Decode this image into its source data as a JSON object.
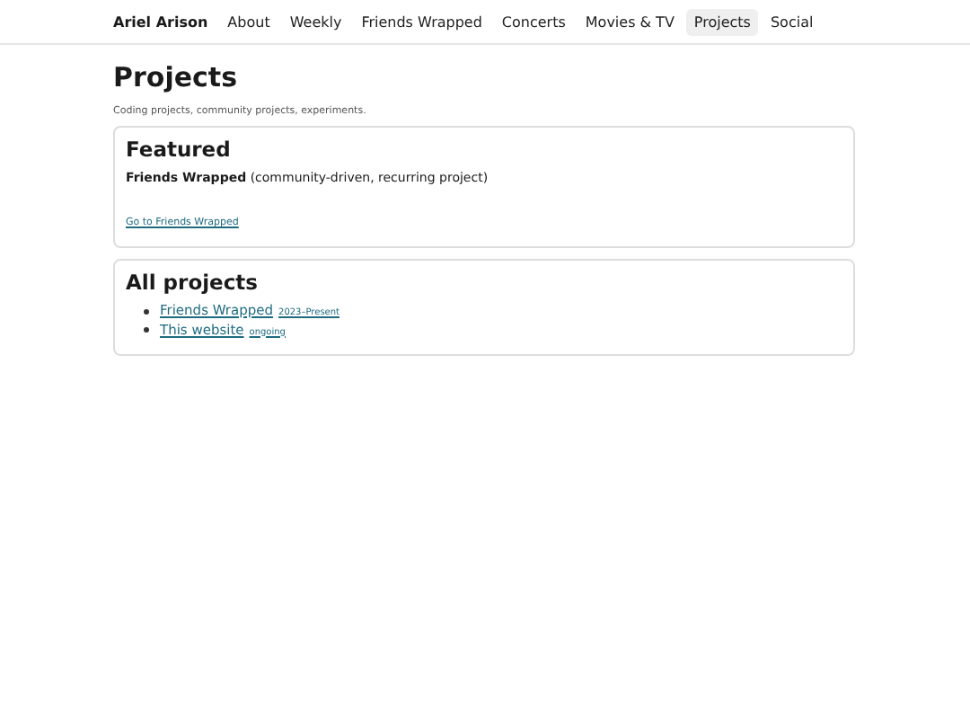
{
  "nav": {
    "brand": "Ariel Arison",
    "links": [
      {
        "label": "About",
        "selected": false
      },
      {
        "label": "Weekly",
        "selected": false
      },
      {
        "label": "Friends Wrapped",
        "selected": false
      },
      {
        "label": "Concerts",
        "selected": false
      },
      {
        "label": "Movies & TV",
        "selected": false
      },
      {
        "label": "Projects",
        "selected": true
      },
      {
        "label": "Social",
        "selected": false
      }
    ]
  },
  "page": {
    "title": "Projects",
    "subtitle": "Coding projects, community projects, experiments."
  },
  "featured": {
    "heading": "Featured",
    "description": "**Friends Wrapped** (community-driven, recurring project)",
    "link": "Go to Friends Wrapped"
  },
  "all_projects": {
    "heading": "All projects",
    "items": [
      {
        "name": "Friends Wrapped",
        "meta": "2023–Present"
      },
      {
        "name": "This website",
        "meta": "ongoing"
      }
    ]
  }
}
